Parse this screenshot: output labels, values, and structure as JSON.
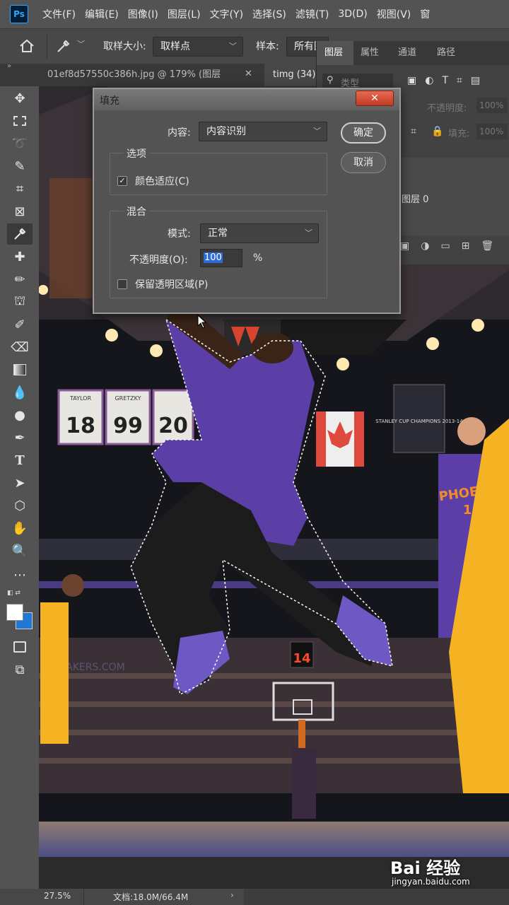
{
  "app": {
    "logo": "Ps"
  },
  "menu": [
    "文件(F)",
    "编辑(E)",
    "图像(I)",
    "图层(L)",
    "文字(Y)",
    "选择(S)",
    "滤镜(T)",
    "3D(D)",
    "视图(V)",
    "窗"
  ],
  "options": {
    "sample_size_label": "取样大小:",
    "sample_size_value": "取样点",
    "sample_label": "样本:",
    "sample_value": "所有图"
  },
  "tabs": [
    {
      "label": "01ef8d57550c386h.jpg @ 179% (图层"
    },
    {
      "label": "timg (34)"
    }
  ],
  "layers_panel": {
    "tabs": [
      "图层",
      "属性",
      "通道",
      "路径"
    ],
    "search_placeholder": "类型",
    "opacity_label": "不透明度:",
    "opacity_value": "100%",
    "fill_label": "填充:",
    "fill_value": "100%",
    "layer_name": "图层 0"
  },
  "dialog": {
    "title": "填充",
    "close_glyph": "✕",
    "content_label": "内容:",
    "content_value": "内容识别",
    "options_group": "选项",
    "color_adapt_label": "颜色适应(C)",
    "color_adapt_checked": true,
    "blend_group": "混合",
    "mode_label": "模式:",
    "mode_value": "正常",
    "opacity_label": "不透明度(O):",
    "opacity_value": "100",
    "opacity_unit": "%",
    "preserve_label": "保留透明区域(P)",
    "preserve_checked": false,
    "ok_label": "确定",
    "cancel_label": "取消"
  },
  "canvas": {
    "banners": [
      "18",
      "99",
      "20"
    ],
    "banner_names": [
      "TAYLOR",
      "GRETZKY",
      ""
    ],
    "champions_text": "STANLEY CUP CHAMPIONS 2013-14",
    "jersey_text": "PHOENIX",
    "jersey_number": "1",
    "shot_clock": "14",
    "arena_text": "LAKERS.COM"
  },
  "status": {
    "zoom": "27.5%",
    "doc": "文档:18.0M/66.4M"
  },
  "watermark": {
    "brand": "Bai 经验",
    "url": "jingyan.baidu.com"
  },
  "colors": {
    "accent": "#31a8ff",
    "foreground": "#ffffff",
    "background": "#1e78d8",
    "suns_purple": "#5b3fa6",
    "lakers_gold": "#f5b324"
  }
}
